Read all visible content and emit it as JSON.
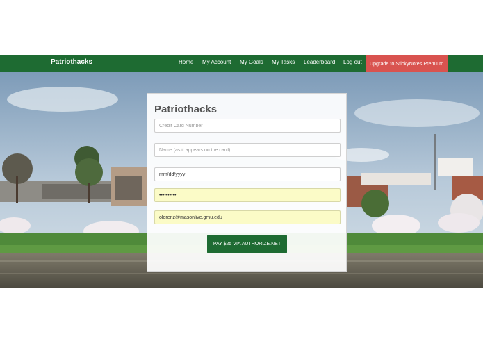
{
  "navbar": {
    "brand": "Patriothacks",
    "links": [
      "Home",
      "My Account",
      "My Goals",
      "My Tasks",
      "Leaderboard",
      "Log out"
    ],
    "upgrade_label": "Upgrade to StickyNotes Premium",
    "bg_color": "#1e6b32",
    "upgrade_color": "#d9534f"
  },
  "form": {
    "title": "Patriothacks",
    "card_number": {
      "placeholder": "Credit Card Number",
      "value": ""
    },
    "name": {
      "placeholder": "Name (as it appears on the card)",
      "value": ""
    },
    "expiry": {
      "placeholder": "mm/dd/yyyy",
      "value": "mm/dd/yyyy"
    },
    "password": {
      "value": "••••••••••"
    },
    "email": {
      "value": "olorenz@masonlive.gmu.edu"
    },
    "pay_label": "PAY $25 VIA AUTHORIZE.NET"
  },
  "background": {
    "description_icon": "campus-lake-photo"
  }
}
